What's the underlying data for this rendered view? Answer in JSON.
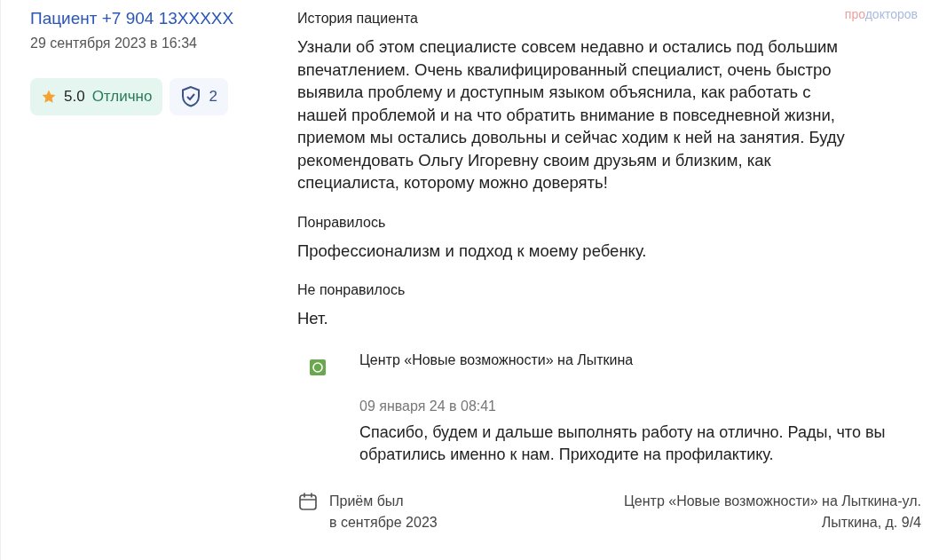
{
  "author": {
    "name": "Пациент +7 904 13XXXXX",
    "date": "29 сентября 2023 в 16:34"
  },
  "rating": {
    "score": "5.0",
    "label": "Отлично"
  },
  "verified": {
    "count": "2"
  },
  "logo": {
    "prefix": "про",
    "suffix": "докторов"
  },
  "sections": [
    {
      "title": "История пациента",
      "text": "Узнали об этом специалисте совсем недавно и остались под большим впечатлением. Очень квалифицированный специалист, очень быстро выявила проблему и доступным языком объяснила, как работать с нашей проблемой и на что обратить внимание в повседневной жизни, приемом мы остались довольны и сейчас ходим к ней на занятия. Буду рекомендовать Ольгу Игоревну своим друзьям и близким, как специалиста, которому можно доверять!"
    },
    {
      "title": "Понравилось",
      "text": "Профессионализм и подход к моему ребенку."
    },
    {
      "title": "Не понравилось",
      "text": "Нет."
    }
  ],
  "reply": {
    "clinic": "Центр «Новые возможности» на Лыткина",
    "date": "09 января 24 в 08:41",
    "text": "Спасибо, будем и дальше выполнять работу на отлично. Рады, что вы обратились именно к нам. Приходите на профилактику."
  },
  "visit": {
    "line_1": "Приём был",
    "line_2": "в сентябре 2023"
  },
  "address": {
    "line_1": "Центр «Новые возможности» на Лыткина-ул.",
    "line_2": "Лыткина, д. 9/4"
  }
}
